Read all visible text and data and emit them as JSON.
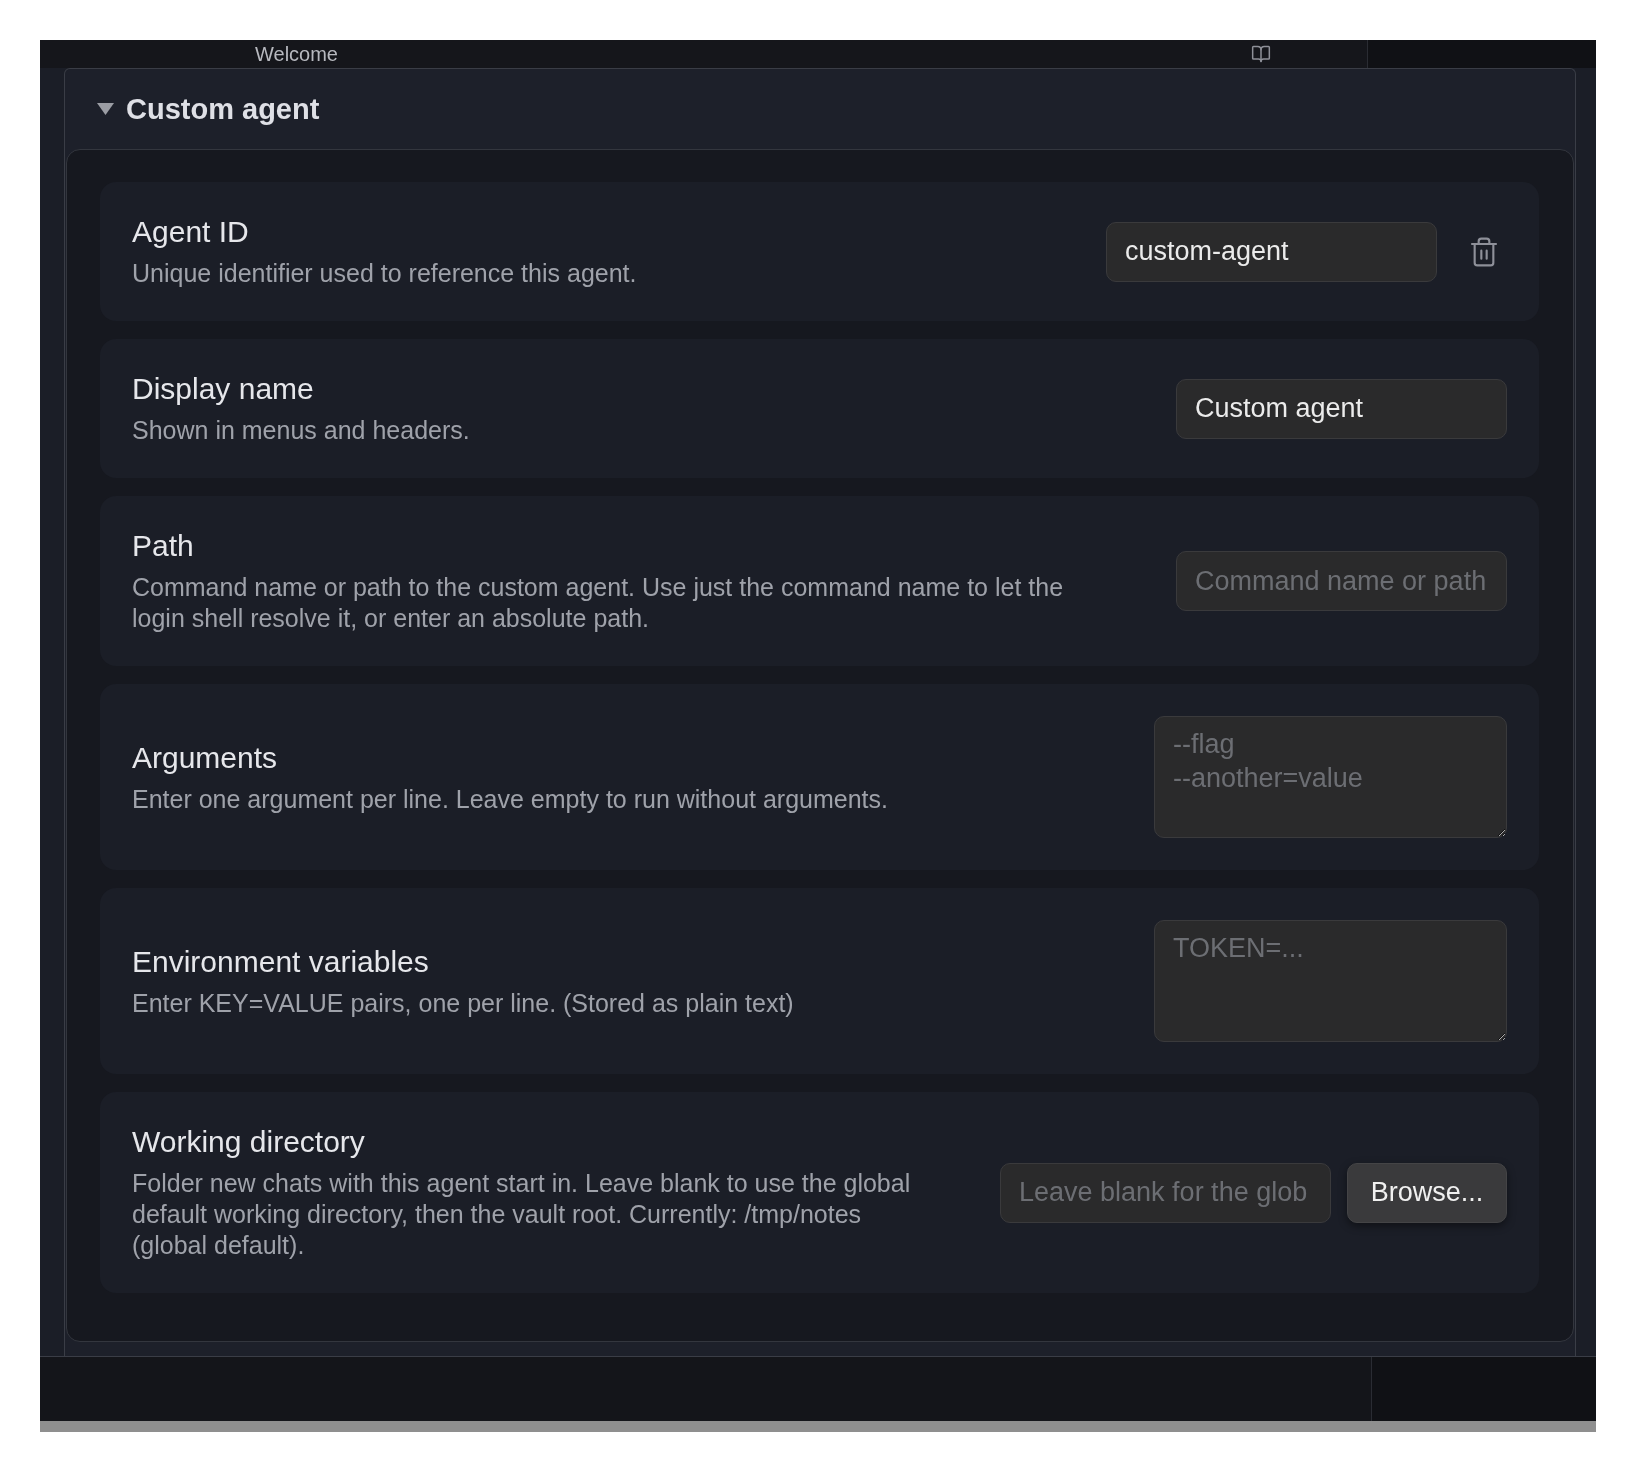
{
  "tab_bar": {
    "title": "Welcome"
  },
  "section": {
    "title": "Custom agent",
    "expanded": true,
    "settings": [
      {
        "kind": "input",
        "label": "Agent ID",
        "description": "Unique identifier used to reference this agent.",
        "value": "custom-agent",
        "delete_button": true
      },
      {
        "kind": "input",
        "label": "Display name",
        "description": "Shown in menus and headers.",
        "value": "Custom agent"
      },
      {
        "kind": "input",
        "label": "Path",
        "description": "Command name or path to the custom agent. Use just the command name to let the login shell resolve it, or enter an absolute path.",
        "placeholder": "Command name or path"
      },
      {
        "kind": "textarea",
        "label": "Arguments",
        "description": "Enter one argument per line. Leave empty to run without arguments.",
        "placeholder": "--flag\n--another=value"
      },
      {
        "kind": "textarea",
        "label": "Environment variables",
        "description": "Enter KEY=VALUE pairs, one per line. (Stored as plain text)",
        "placeholder": "TOKEN=..."
      },
      {
        "kind": "input",
        "label": "Working directory",
        "description": "Folder new chats with this agent start in. Leave blank to use the global default working directory, then the vault root. Currently: /tmp/notes (global default).",
        "placeholder": "Leave blank for the glob",
        "button": "Browse..."
      }
    ]
  }
}
